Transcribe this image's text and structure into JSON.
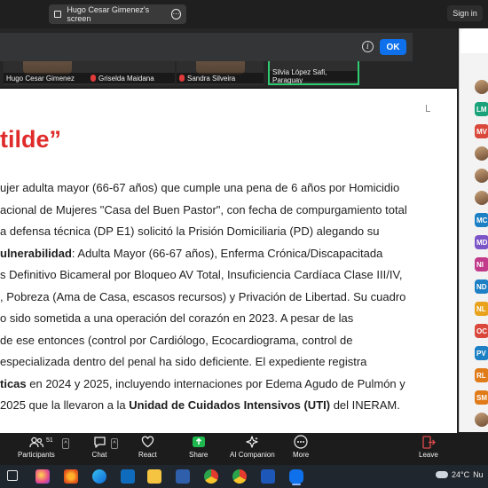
{
  "topbar": {
    "share_title": "Hugo Cesar Gimenez's screen",
    "more_glyph": "⋯",
    "signin_label": "Sign in"
  },
  "participants_strip": [
    {
      "name": "Hugo Cesar Gimenez",
      "muted": false,
      "active": false
    },
    {
      "name": "Griselda Maidana",
      "muted": true,
      "active": false
    },
    {
      "name": "Sandra Silveira",
      "muted": true,
      "active": false
    },
    {
      "name": "Silvia López Safi, Paraguay",
      "muted": false,
      "active": true
    }
  ],
  "notice": {
    "info_glyph": "i",
    "ok_label": "OK"
  },
  "document": {
    "title": "tilde”",
    "lines": [
      [
        {
          "t": "ujer adulta mayor (66-67 años) que cumple una pena de 6 años por Homicidio",
          "b": false
        }
      ],
      [
        {
          "t": "acional de Mujeres \"Casa del Buen Pastor\", con fecha de compurgamiento total",
          "b": false
        }
      ],
      [
        {
          "t": "a defensa técnica (DP E1) solicitó la Prisión Domiciliaria (PD) alegando su",
          "b": false
        }
      ],
      [
        {
          "t": "ulnerabilidad",
          "b": true
        },
        {
          "t": ": Adulta Mayor (66-67 años), Enferma Crónica/Discapacitada",
          "b": false
        }
      ],
      [
        {
          "t": "s Definitivo Bicameral por Bloqueo AV Total, Insuficiencia Cardíaca Clase III/IV,",
          "b": false
        }
      ],
      [
        {
          "t": ", Pobreza (Ama de Casa, escasos recursos) y Privación de Libertad. Su cuadro",
          "b": false
        }
      ],
      [
        {
          "t": "o sido sometida a una operación del corazón en 2023. A pesar de las",
          "b": false
        }
      ],
      [
        {
          "t": "de ese entonces (control por Cardiólogo, Ecocardiograma, control de",
          "b": false
        }
      ],
      [
        {
          "t": "especializada dentro del penal ha sido deficiente. El expediente registra",
          "b": false
        }
      ],
      [
        {
          "t": "ticas",
          "b": true
        },
        {
          "t": " en 2024 y 2025, incluyendo internaciones por Edema Agudo de Pulmón y",
          "b": false
        }
      ],
      [
        {
          "t": "2025 que la llevaron a la ",
          "b": false
        },
        {
          "t": "Unidad de Cuidados Intensivos (UTI)",
          "b": true
        },
        {
          "t": " del INERAM.",
          "b": false
        }
      ]
    ]
  },
  "right_panel": {
    "avatars": [
      {
        "label": "",
        "color": "#b08968",
        "photo": true
      },
      {
        "label": "LM",
        "color": "#1aa37a",
        "photo": false
      },
      {
        "label": "MV",
        "color": "#d9483b",
        "photo": false
      },
      {
        "label": "",
        "color": "#b08968",
        "photo": true
      },
      {
        "label": "",
        "color": "#b08968",
        "photo": true
      },
      {
        "label": "",
        "color": "#b08968",
        "photo": true
      },
      {
        "label": "MC",
        "color": "#1d7fc4",
        "photo": false
      },
      {
        "label": "MD",
        "color": "#7b55c7",
        "photo": false
      },
      {
        "label": "NI",
        "color": "#c23b8a",
        "photo": false
      },
      {
        "label": "ND",
        "color": "#1d7fc4",
        "photo": false
      },
      {
        "label": "NL",
        "color": "#e8a21c",
        "photo": false
      },
      {
        "label": "OC",
        "color": "#d9483b",
        "photo": false
      },
      {
        "label": "PV",
        "color": "#1d7fc4",
        "photo": false
      },
      {
        "label": "RL",
        "color": "#e07b1a",
        "photo": false
      },
      {
        "label": "SM",
        "color": "#e07b1a",
        "photo": false
      },
      {
        "label": "",
        "color": "#b08968",
        "photo": true
      }
    ]
  },
  "toolbar": {
    "participants_label": "Participants",
    "participants_count": "51",
    "chat_label": "Chat",
    "react_label": "React",
    "share_label": "Share",
    "ai_label": "AI Companion",
    "more_label": "More",
    "leave_label": "Leave"
  },
  "taskbar": {
    "temperature": "24°C",
    "condition": "Nu",
    "accent": "#0e71eb"
  }
}
